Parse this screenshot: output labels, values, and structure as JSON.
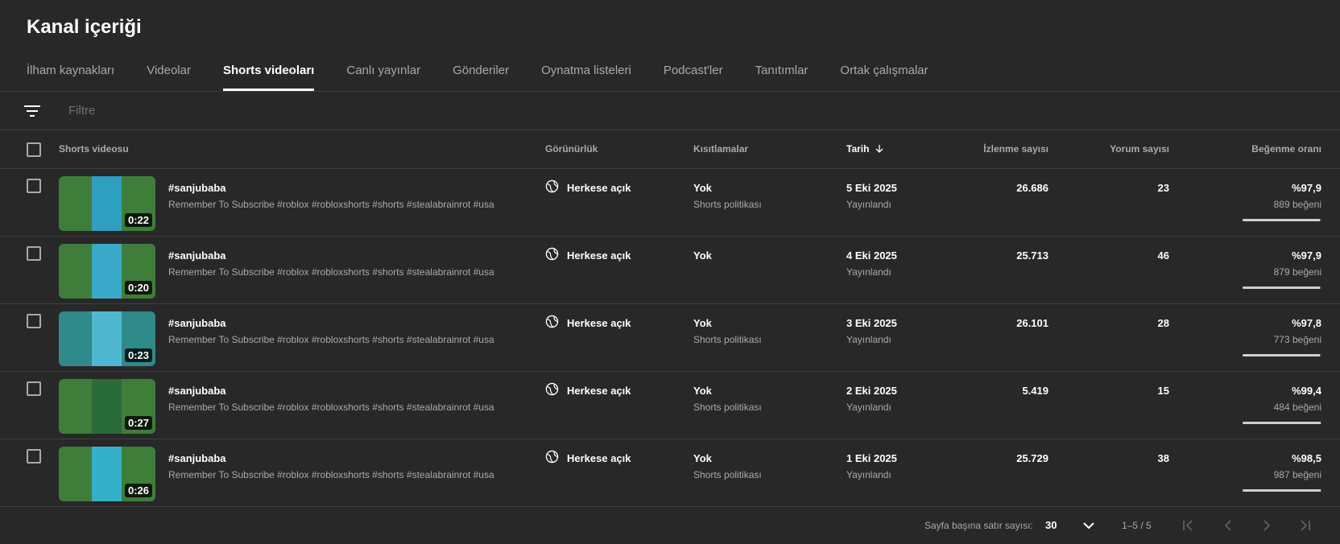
{
  "page_title": "Kanal içeriği",
  "tabs": [
    {
      "label": "İlham kaynakları"
    },
    {
      "label": "Videolar"
    },
    {
      "label": "Shorts videoları"
    },
    {
      "label": "Canlı yayınlar"
    },
    {
      "label": "Gönderiler"
    },
    {
      "label": "Oynatma listeleri"
    },
    {
      "label": "Podcast'ler"
    },
    {
      "label": "Tanıtımlar"
    },
    {
      "label": "Ortak çalışmalar"
    }
  ],
  "active_tab_index": 2,
  "filter": {
    "placeholder": "Filtre",
    "icon": "filter-icon"
  },
  "table": {
    "headers": {
      "video": "Shorts videosu",
      "visibility": "Görünürlük",
      "restrictions": "Kısıtlamalar",
      "date": "Tarih",
      "views": "İzlenme sayısı",
      "comments": "Yorum sayısı",
      "like_ratio": "Beğenme oranı"
    },
    "sort_icon": "arrow-down-icon",
    "rows": [
      {
        "title": "#sanjubaba",
        "description": "Remember To Subscribe #roblox #robloxshorts #shorts #stealabrainrot #usa",
        "duration": "0:22",
        "visibility": "Herkese açık",
        "restriction": "Yok",
        "restriction_note": "Shorts politikası",
        "date": "5 Eki 2025",
        "status": "Yayınlandı",
        "views": "26.686",
        "comments": "23",
        "like_ratio": "%97,9",
        "likes": "889 beğeni",
        "ratio_fraction": 0.979,
        "thumb_color": "#3f7d3a",
        "poster_color": "#2f9fbf"
      },
      {
        "title": "#sanjubaba",
        "description": "Remember To Subscribe #roblox #robloxshorts #shorts #stealabrainrot #usa",
        "duration": "0:20",
        "visibility": "Herkese açık",
        "restriction": "Yok",
        "restriction_note": "",
        "date": "4 Eki 2025",
        "status": "Yayınlandı",
        "views": "25.713",
        "comments": "46",
        "like_ratio": "%97,9",
        "likes": "879 beğeni",
        "ratio_fraction": 0.979,
        "thumb_color": "#3f7d3a",
        "poster_color": "#3aa8c8"
      },
      {
        "title": "#sanjubaba",
        "description": "Remember To Subscribe #roblox #robloxshorts #shorts #stealabrainrot #usa",
        "duration": "0:23",
        "visibility": "Herkese açık",
        "restriction": "Yok",
        "restriction_note": "Shorts politikası",
        "date": "3 Eki 2025",
        "status": "Yayınlandı",
        "views": "26.101",
        "comments": "28",
        "like_ratio": "%97,8",
        "likes": "773 beğeni",
        "ratio_fraction": 0.978,
        "thumb_color": "#2f8a8a",
        "poster_color": "#4fb8d0"
      },
      {
        "title": "#sanjubaba",
        "description": "Remember To Subscribe #roblox #robloxshorts #shorts #stealabrainrot #usa",
        "duration": "0:27",
        "visibility": "Herkese açık",
        "restriction": "Yok",
        "restriction_note": "Shorts politikası",
        "date": "2 Eki 2025",
        "status": "Yayınlandı",
        "views": "5.419",
        "comments": "15",
        "like_ratio": "%99,4",
        "likes": "484 beğeni",
        "ratio_fraction": 0.994,
        "thumb_color": "#3f7d3a",
        "poster_color": "#2a6b3a"
      },
      {
        "title": "#sanjubaba",
        "description": "Remember To Subscribe #roblox #robloxshorts #shorts #stealabrainrot #usa",
        "duration": "0:26",
        "visibility": "Herkese açık",
        "restriction": "Yok",
        "restriction_note": "Shorts politikası",
        "date": "1 Eki 2025",
        "status": "Yayınlandı",
        "views": "25.729",
        "comments": "38",
        "like_ratio": "%98,5",
        "likes": "987 beğeni",
        "ratio_fraction": 0.985,
        "thumb_color": "#3f7d3a",
        "poster_color": "#36b0c8"
      }
    ]
  },
  "pagination": {
    "rows_per_page_label": "Sayfa başına satır sayısı:",
    "rows_per_page": "30",
    "range": "1–5 / 5"
  },
  "colors": {
    "background": "#282828",
    "divider": "#3e3e3e",
    "muted_text": "#aaaaaa"
  }
}
